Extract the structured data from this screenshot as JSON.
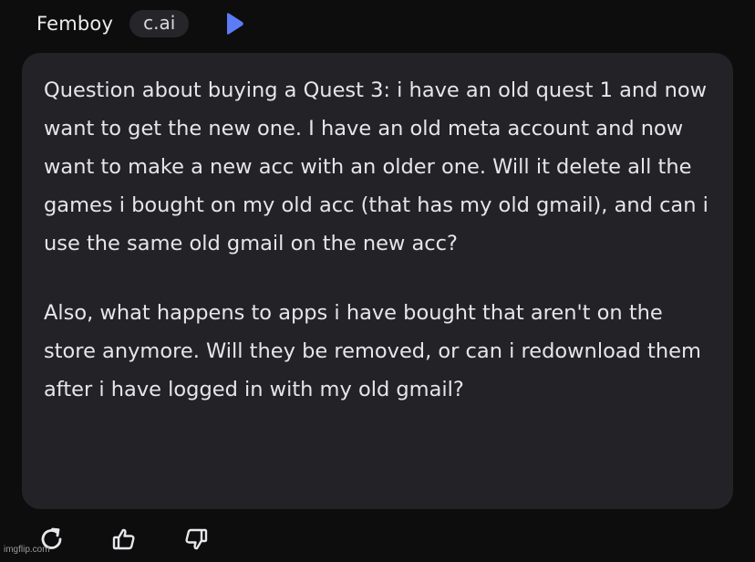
{
  "header": {
    "character_name": "Femboy",
    "badge": "c.ai",
    "play_icon": "play-icon",
    "accent_color": "#5b7cf6"
  },
  "message": {
    "paragraphs": [
      "Question about buying a Quest 3: i have an old quest 1 and now want to get the new one. I have an old meta account and now want to make a new acc with an older one. Will it delete all the games i bought on my old acc (that has my old gmail), and can i use the same old gmail on the new acc?",
      "Also, what happens to apps i have bought that aren't on the store anymore. Will they be removed, or can i redownload them after i have logged in with my old gmail?"
    ],
    "bubble_color": "#232327"
  },
  "actions": {
    "icons": [
      "regenerate-icon",
      "thumbs-up-icon",
      "thumbs-down-icon"
    ]
  },
  "watermark": "imgflip.com"
}
